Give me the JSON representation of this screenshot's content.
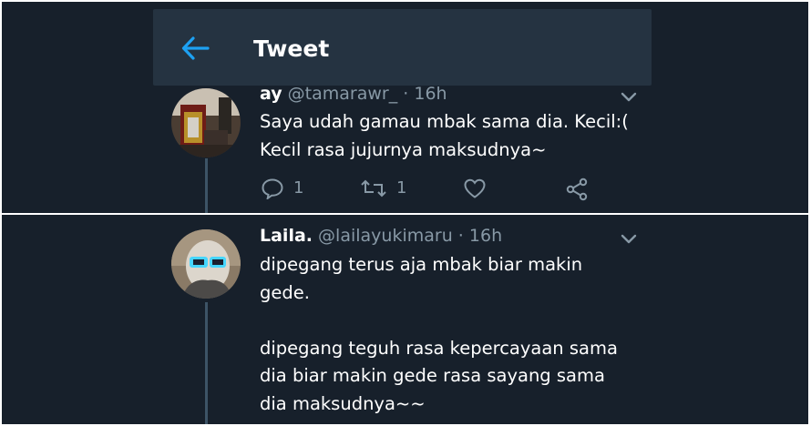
{
  "header": {
    "title": "Tweet",
    "back_icon": "arrow-left-icon",
    "accent": "#1da1f2"
  },
  "tweets": [
    {
      "display_name": "ay",
      "handle": "@tamarawr_",
      "separator": "·",
      "time": "16h",
      "lines": [
        "Saya udah gamau mbak sama dia. Kecil:(",
        "Kecil rasa jujurnya maksudnya~"
      ],
      "actions": {
        "reply_count": "1",
        "retweet_count": "1",
        "reply_icon": "reply-icon",
        "retweet_icon": "retweet-icon",
        "like_icon": "heart-icon",
        "share_icon": "share-icon"
      }
    },
    {
      "display_name": "Laila.",
      "handle": "@lailayukimaru",
      "separator": "·",
      "time": "16h",
      "lines": [
        "dipegang terus aja mbak biar makin",
        "gede.",
        "",
        "dipegang teguh rasa kepercayaan sama",
        "dia biar makin gede rasa sayang sama",
        "dia maksudnya~~"
      ]
    }
  ],
  "colors": {
    "background": "#17202b",
    "header": "#253341",
    "text_primary": "#ffffff",
    "text_secondary": "#8899a6"
  }
}
